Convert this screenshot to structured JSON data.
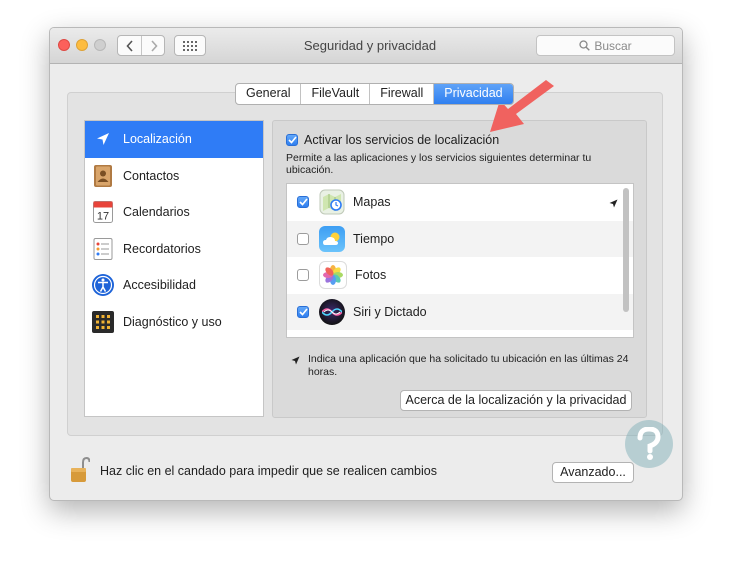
{
  "window": {
    "title": "Seguridad y privacidad"
  },
  "search": {
    "placeholder": "Buscar"
  },
  "tabs": [
    {
      "label": "General",
      "active": false
    },
    {
      "label": "FileVault",
      "active": false
    },
    {
      "label": "Firewall",
      "active": false
    },
    {
      "label": "Privacidad",
      "active": true
    }
  ],
  "sidebar": {
    "items": [
      {
        "label": "Localización",
        "icon": "location-arrow-icon",
        "active": true
      },
      {
        "label": "Contactos",
        "icon": "contacts-book-icon",
        "active": false
      },
      {
        "label": "Calendarios",
        "icon": "calendar-icon",
        "active": false
      },
      {
        "label": "Recordatorios",
        "icon": "reminders-list-icon",
        "active": false
      },
      {
        "label": "Accesibilidad",
        "icon": "accessibility-person-icon",
        "active": false
      },
      {
        "label": "Diagnóstico y uso",
        "icon": "diagnostics-grid-icon",
        "active": false
      }
    ]
  },
  "location": {
    "enable_label": "Activar los servicios de localización",
    "enabled": true,
    "description": "Permite a las aplicaciones y los servicios siguientes determinar tu ubicación.",
    "apps": [
      {
        "name": "Mapas",
        "checked": true,
        "icon": "maps-app-icon",
        "recent": true
      },
      {
        "name": "Tiempo",
        "checked": false,
        "icon": "weather-app-icon",
        "recent": false
      },
      {
        "name": "Fotos",
        "checked": false,
        "icon": "photos-app-icon",
        "recent": false
      },
      {
        "name": "Siri y Dictado",
        "checked": true,
        "icon": "siri-app-icon",
        "recent": false
      }
    ],
    "note": "Indica una aplicación que ha solicitado tu ubicación en las últimas 24 horas.",
    "about_button": "Acerca de la localización y la privacidad"
  },
  "footer": {
    "lock_text": "Haz clic en el candado para impedir que se realicen cambios",
    "advanced_button": "Avanzado..."
  },
  "colors": {
    "accent": "#2f7cf6",
    "highlight_arrow": "#f0625f"
  }
}
